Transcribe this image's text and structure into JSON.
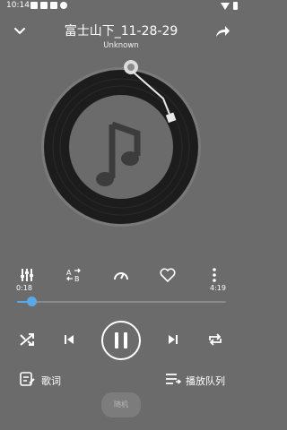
{
  "status": {
    "time": "10:14"
  },
  "header": {
    "title": "富士山下_11-28-29",
    "artist": "Unknown"
  },
  "progress": {
    "elapsed": "0:18",
    "duration": "4:19",
    "fraction": 0.07
  },
  "actions": {
    "lyrics_label": "歌词",
    "queue_label": "播放队列",
    "bottom_pill": "随机"
  },
  "colors": {
    "background": "#6b6b6b",
    "accent": "#5aa9e6"
  }
}
